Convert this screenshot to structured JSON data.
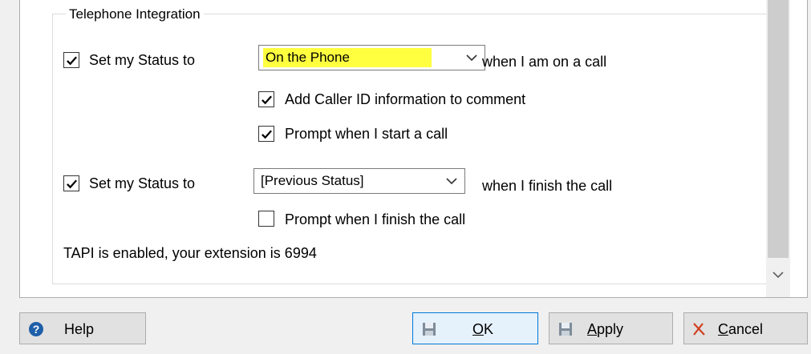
{
  "group": {
    "title": "Telephone Integration"
  },
  "rows": {
    "call_start": {
      "checked": true,
      "label": "Set my Status to",
      "status_value": "On the Phone",
      "suffix": "when I am on a call"
    },
    "caller_id": {
      "checked": true,
      "label": "Add Caller ID information to comment"
    },
    "prompt_start": {
      "checked": true,
      "label": "Prompt when I start a call"
    },
    "call_finish": {
      "checked": true,
      "label": "Set my Status to",
      "status_value": "[Previous Status]",
      "suffix": "when I finish the call"
    },
    "prompt_finish": {
      "checked": false,
      "label": "Prompt when I finish the call"
    }
  },
  "tapi_status": "TAPI is enabled, your extension is 6994",
  "buttons": {
    "help": {
      "label": "Help",
      "icon": "help-icon"
    },
    "ok": {
      "mnemonic": "O",
      "rest": "K",
      "icon": "floppy-disk-icon"
    },
    "apply": {
      "mnemonic": "A",
      "rest": "pply",
      "icon": "floppy-disk-icon"
    },
    "cancel": {
      "mnemonic": "C",
      "rest": "ancel",
      "icon": "cancel-x-icon"
    }
  },
  "colors": {
    "highlight": "#ffff40",
    "focus_border": "#0078d7",
    "help_icon": "#1f5fa8",
    "cancel_icon": "#d04020"
  }
}
